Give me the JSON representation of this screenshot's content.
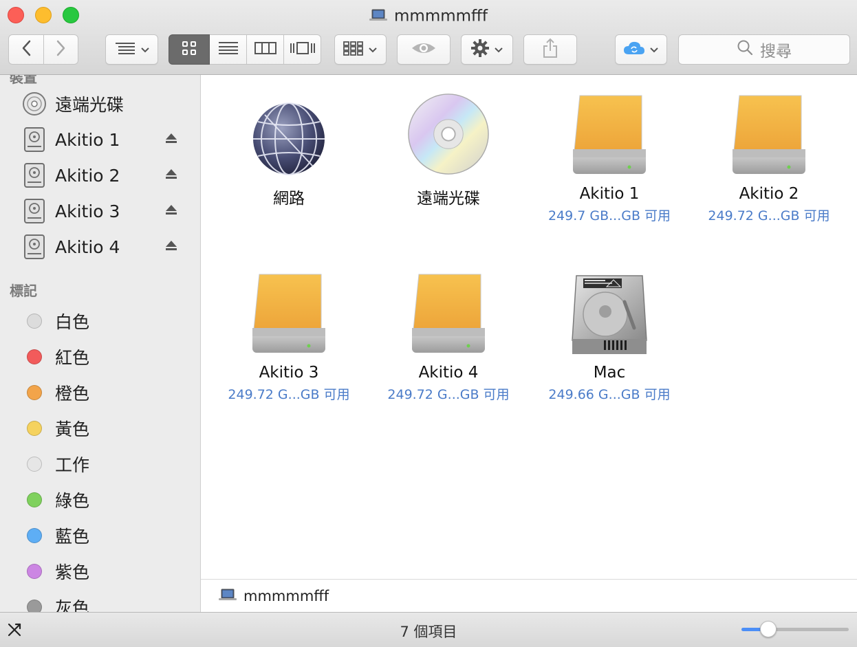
{
  "window": {
    "title": "mmmmmfff"
  },
  "toolbar": {
    "search_placeholder": "搜尋",
    "icons": {
      "back": "chevron-left-icon",
      "forward": "chevron-right-icon",
      "arrange": "list-arrange-icon",
      "icon_view": "grid-icon",
      "list_view": "list-icon",
      "column_view": "columns-icon",
      "cover_flow": "coverflow-icon",
      "group": "group-icon",
      "quick_look": "eye-icon",
      "action": "gear-icon",
      "share": "share-icon",
      "icloud": "icloud-sync-icon",
      "search": "search-icon"
    }
  },
  "sidebar": {
    "devices_heading": "裝置",
    "devices": [
      {
        "label": "遠端光碟",
        "icon": "cd-icon",
        "eject": false
      },
      {
        "label": "Akitio 1",
        "icon": "disk-icon",
        "eject": true
      },
      {
        "label": "Akitio 2",
        "icon": "disk-icon",
        "eject": true
      },
      {
        "label": "Akitio 3",
        "icon": "disk-icon",
        "eject": true
      },
      {
        "label": "Akitio 4",
        "icon": "disk-icon",
        "eject": true
      }
    ],
    "tags_heading": "標記",
    "tags": [
      {
        "label": "白色",
        "color": "#dcdcdc"
      },
      {
        "label": "紅色",
        "color": "#f25b5b"
      },
      {
        "label": "橙色",
        "color": "#f2a44a"
      },
      {
        "label": "黃色",
        "color": "#f5d25e"
      },
      {
        "label": "工作",
        "color": "#e6e6e6"
      },
      {
        "label": "綠色",
        "color": "#7fd15d"
      },
      {
        "label": "藍色",
        "color": "#5eaef5"
      },
      {
        "label": "紫色",
        "color": "#cc86e3"
      },
      {
        "label": "灰色",
        "color": "#9a9a9a"
      }
    ]
  },
  "content": {
    "items": [
      {
        "name": "網路",
        "info": "",
        "icon": "network-globe-icon"
      },
      {
        "name": "遠端光碟",
        "info": "",
        "icon": "optical-disc-icon"
      },
      {
        "name": "Akitio 1",
        "info": "249.7 GB...GB 可用",
        "icon": "external-drive-icon"
      },
      {
        "name": "Akitio 2",
        "info": "249.72 G...GB 可用",
        "icon": "external-drive-icon"
      },
      {
        "name": "Akitio 3",
        "info": "249.72 G...GB 可用",
        "icon": "external-drive-icon"
      },
      {
        "name": "Akitio 4",
        "info": "249.72 G...GB 可用",
        "icon": "external-drive-icon"
      },
      {
        "name": "Mac",
        "info": "249.66 G...GB 可用",
        "icon": "internal-hard-drive-icon"
      }
    ]
  },
  "pathbar": {
    "label": "mmmmmfff"
  },
  "statusbar": {
    "count": "7 個項目",
    "zoom_level": 0.25
  },
  "colors": {
    "accent": "#4b8ef7",
    "info_text": "#4a7bc8",
    "drive_orange": "#f0b03c"
  }
}
